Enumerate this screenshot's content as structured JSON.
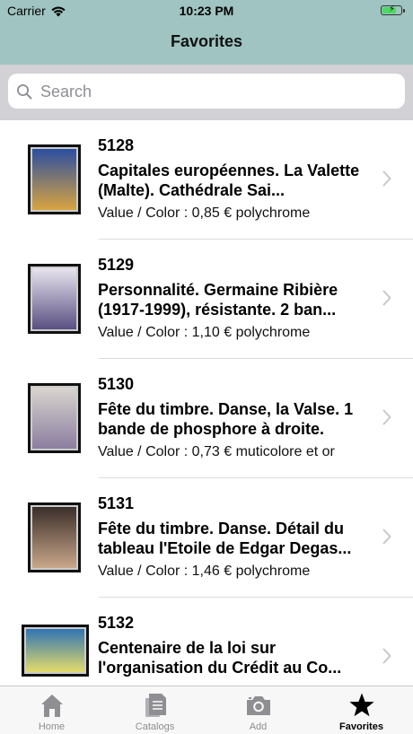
{
  "status": {
    "carrier": "Carrier",
    "time": "10:23 PM"
  },
  "nav": {
    "title": "Favorites"
  },
  "search": {
    "placeholder": "Search",
    "value": ""
  },
  "stamps": [
    {
      "number": "5128",
      "title": "Capitales européennes. La Valette (Malte). Cathédrale Sai...",
      "value": "Value / Color : 0,85 € polychrome",
      "thumb_colors": [
        "#2b4ea1",
        "#d9a441"
      ]
    },
    {
      "number": "5129",
      "title": "Personnalité. Germaine Ribière (1917-1999), résistante. 2 ban...",
      "value": "Value / Color : 1,10 € polychrome",
      "thumb_colors": [
        "#e8e4ee",
        "#5a4f82"
      ]
    },
    {
      "number": "5130",
      "title": "Fête du timbre. Danse, la Valse. 1 bande de phosphore à droite.",
      "value": "Value / Color : 0,73 € muticolore et or",
      "thumb_colors": [
        "#d9d4cf",
        "#8b7ea0"
      ]
    },
    {
      "number": "5131",
      "title": "Fête du timbre. Danse. Détail du tableau l'Etoile de Edgar Degas...",
      "value": "Value / Color : 1,46 € polychrome",
      "thumb_colors": [
        "#3b2e2a",
        "#c9a78a"
      ]
    },
    {
      "number": "5132",
      "title": "Centenaire de la loi sur l'organisation du Crédit au Co...",
      "value": "",
      "thumb_colors": [
        "#2f74b5",
        "#e4dc6a"
      ]
    }
  ],
  "tabs": [
    {
      "label": "Home",
      "icon": "home-icon",
      "active": false
    },
    {
      "label": "Catalogs",
      "icon": "catalog-icon",
      "active": false
    },
    {
      "label": "Add",
      "icon": "camera-icon",
      "active": false
    },
    {
      "label": "Favorites",
      "icon": "star-icon",
      "active": true
    }
  ],
  "colors": {
    "nav_bg": "#9fc4c1",
    "search_bg": "#d1d1d6",
    "battery": "#4cd964",
    "tab_inactive": "#8e8e93",
    "tab_active": "#000000"
  }
}
